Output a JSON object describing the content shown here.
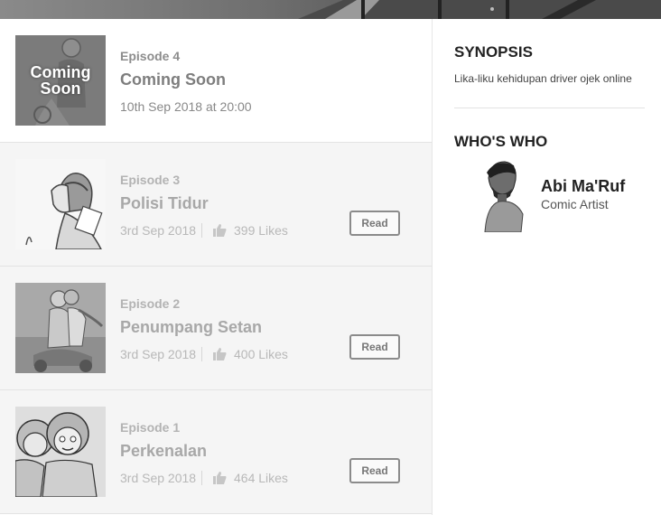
{
  "episodes": [
    {
      "number": "Episode 4",
      "title": "Coming Soon",
      "date": "10th Sep 2018 at 20:00",
      "thumb_overlay": "Coming Soon",
      "status": "coming"
    },
    {
      "number": "Episode 3",
      "title": "Polisi Tidur",
      "date": "3rd Sep 2018",
      "likes": "399 Likes",
      "read_label": "Read",
      "status": "released"
    },
    {
      "number": "Episode 2",
      "title": "Penumpang Setan",
      "date": "3rd Sep 2018",
      "likes": "400 Likes",
      "read_label": "Read",
      "status": "released"
    },
    {
      "number": "Episode 1",
      "title": "Perkenalan",
      "date": "3rd Sep 2018",
      "likes": "464 Likes",
      "read_label": "Read",
      "status": "released"
    }
  ],
  "sidebar": {
    "synopsis_heading": "SYNOPSIS",
    "synopsis_text": "Lika-liku kehidupan driver ojek online",
    "whoswho_heading": "WHO'S WHO",
    "author": {
      "name": "Abi Ma'Ruf",
      "role": "Comic Artist"
    }
  },
  "colors": {
    "button_border": "#8b8b8b",
    "released_row_bg": "#f5f5f5",
    "divider": "#e3e3e3"
  },
  "icons": [
    "like-icon"
  ]
}
